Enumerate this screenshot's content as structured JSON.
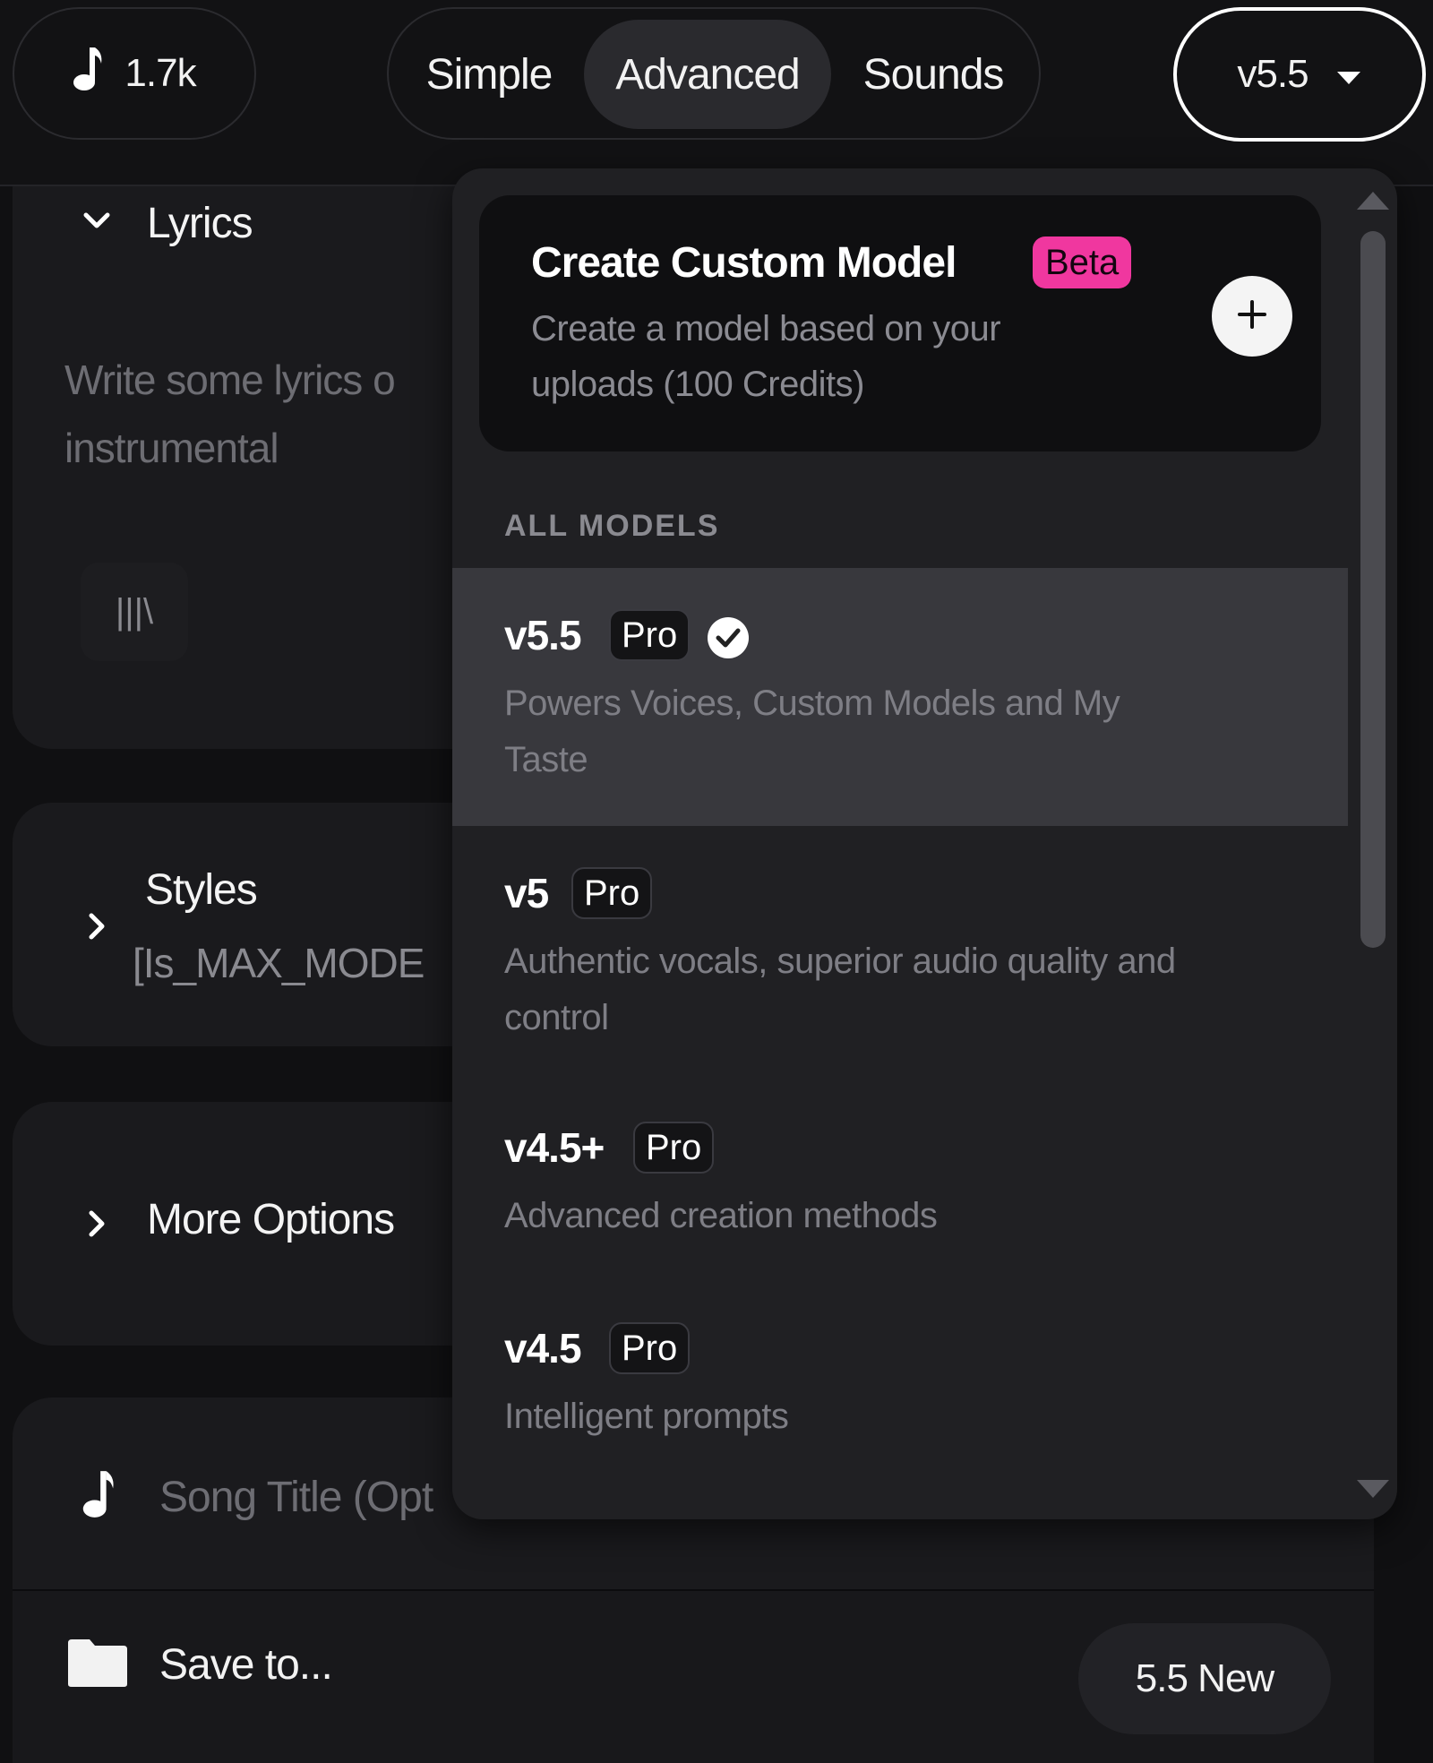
{
  "header": {
    "count": "1.7k",
    "tabs": [
      {
        "label": "Simple"
      },
      {
        "label": "Advanced"
      },
      {
        "label": "Sounds"
      }
    ],
    "active_tab": "Advanced",
    "version": "v5.5"
  },
  "lyrics": {
    "title": "Lyrics",
    "placeholder_line1": "Write some lyrics o",
    "placeholder_line2": "instrumental",
    "tool_glyph": "|||\\"
  },
  "styles": {
    "title": "Styles",
    "value": "[Is_MAX_MODE"
  },
  "more_options": {
    "title": "More Options"
  },
  "song_title": {
    "placeholder": "Song Title (Opt"
  },
  "bottom": {
    "save_label": "Save to...",
    "new_label": "5.5 New"
  },
  "dropdown": {
    "custom": {
      "title": "Create Custom Model",
      "badge": "Beta",
      "desc_line1": "Create a model based on your",
      "desc_line2": "uploads (100 Credits)"
    },
    "section_label": "ALL MODELS",
    "models": [
      {
        "name": "v5.5",
        "badge": "Pro",
        "desc_line1": "Powers Voices, Custom Models and My",
        "desc_line2": "Taste",
        "selected": true
      },
      {
        "name": "v5",
        "badge": "Pro",
        "desc_line1": "Authentic vocals, superior audio quality and",
        "desc_line2": "control",
        "selected": false
      },
      {
        "name": "v4.5+",
        "badge": "Pro",
        "desc_line1": "Advanced creation methods",
        "desc_line2": "",
        "selected": false
      },
      {
        "name": "v4.5",
        "badge": "Pro",
        "desc_line1": "Intelligent prompts",
        "desc_line2": "",
        "selected": false
      }
    ]
  },
  "colors": {
    "beta_badge": "#f0379f",
    "selected_row": "#38383d",
    "background": "#101012"
  },
  "icons": [
    "music-note-icon",
    "caret-down-icon",
    "chevron-down-icon",
    "chevron-right-icon",
    "plus-icon",
    "check-circle-icon",
    "folder-icon",
    "scroll-up-icon",
    "scroll-down-icon"
  ]
}
